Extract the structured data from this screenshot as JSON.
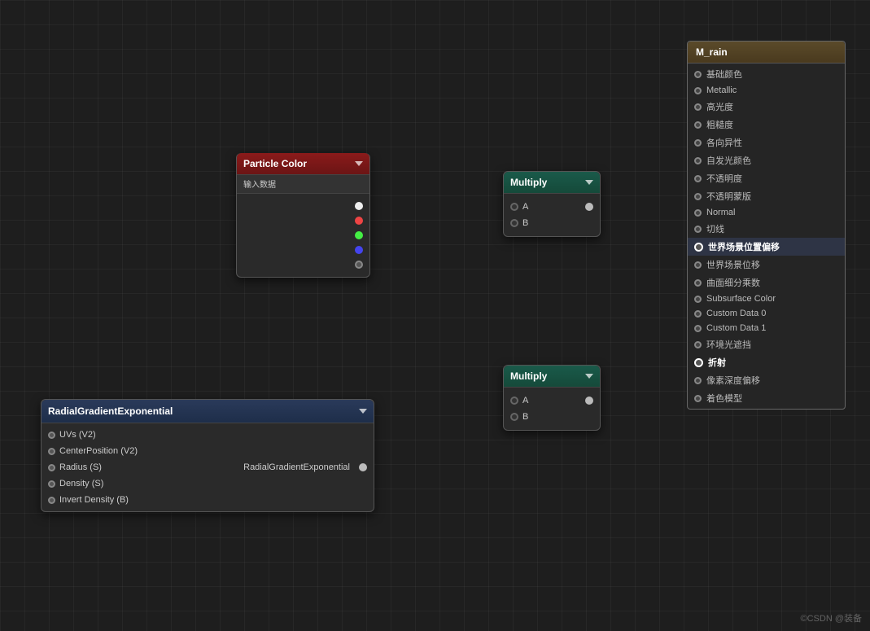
{
  "canvas": {
    "background": "#1e1e1e"
  },
  "watermark": "©CSDN @装备",
  "nodes": {
    "particle_color": {
      "title": "Particle Color",
      "subtitle": "输入数据",
      "pins": [
        "white",
        "red",
        "green",
        "blue",
        "gray"
      ]
    },
    "multiply1": {
      "title": "Multiply",
      "pin_a_label": "A",
      "pin_b_label": "B"
    },
    "multiply2": {
      "title": "Multiply",
      "pin_a_label": "A",
      "pin_b_label": "B"
    },
    "radial_gradient": {
      "title": "RadialGradientExponential",
      "output_label": "RadialGradientExponential",
      "inputs": [
        "UVs (V2)",
        "CenterPosition (V2)",
        "Radius (S)",
        "Density (S)",
        "Invert Density (B)"
      ]
    },
    "m_rain": {
      "title": "M_rain",
      "rows": [
        {
          "label": "基础颜色",
          "bold": false
        },
        {
          "label": "Metallic",
          "bold": false
        },
        {
          "label": "高光度",
          "bold": false
        },
        {
          "label": "粗糙度",
          "bold": false
        },
        {
          "label": "各向异性",
          "bold": false
        },
        {
          "label": "自发光颜色",
          "bold": false
        },
        {
          "label": "不透明度",
          "bold": false
        },
        {
          "label": "不透明蒙版",
          "bold": false
        },
        {
          "label": "Normal",
          "bold": false
        },
        {
          "label": "切线",
          "bold": false
        },
        {
          "label": "世界场景位置偏移",
          "bold": true,
          "highlighted": true
        },
        {
          "label": "世界场景位移",
          "bold": false
        },
        {
          "label": "曲面细分乘数",
          "bold": false
        },
        {
          "label": "Subsurface Color",
          "bold": false
        },
        {
          "label": "Custom Data 0",
          "bold": false
        },
        {
          "label": "Custom Data 1",
          "bold": false
        },
        {
          "label": "环境光遮挡",
          "bold": false
        },
        {
          "label": "折射",
          "bold": true
        },
        {
          "label": "像素深度偏移",
          "bold": false
        },
        {
          "label": "着色模型",
          "bold": false
        }
      ]
    }
  }
}
